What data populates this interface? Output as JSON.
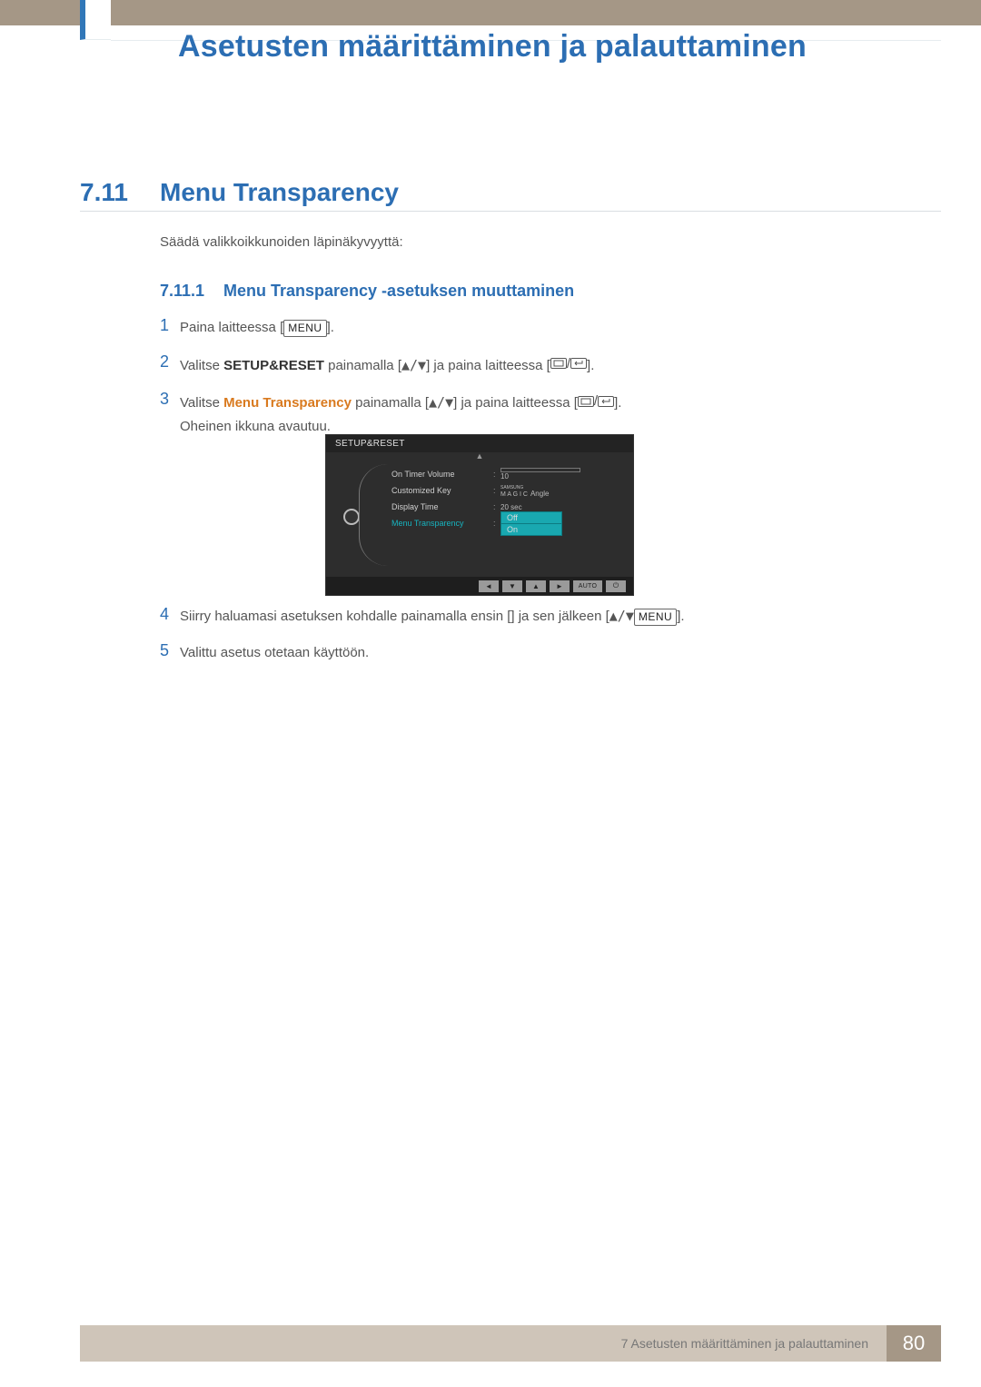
{
  "chapter_title": "Asetusten määrittäminen ja palauttaminen",
  "section": {
    "number": "7.11",
    "title": "Menu Transparency"
  },
  "intro_paragraph": "Säädä valikkoikkunoiden läpinäkyvyyttä:",
  "subsection": {
    "number": "7.11.1",
    "title": "Menu Transparency -asetuksen muuttaminen"
  },
  "buttons": {
    "menu": "MENU"
  },
  "steps": [
    {
      "n": "1",
      "before": "Paina laitteessa [",
      "insert": "menu",
      "after": "]."
    },
    {
      "n": "2",
      "before": "Valitse ",
      "highlight": "SETUP&RESET",
      "highlight_class": "bold-dark",
      "mid": " painamalla [",
      "arrows": true,
      "mid2": "] ja paina laitteessa [",
      "rt": true,
      "after": "]."
    },
    {
      "n": "3",
      "before": "Valitse ",
      "highlight": "Menu Transparency",
      "highlight_class": "bold-orange",
      "mid": " painamalla [",
      "arrows": true,
      "mid2": "] ja paina laitteessa [",
      "rt": true,
      "after": "].",
      "tail": "Oheinen ikkuna avautuu."
    }
  ],
  "osd": {
    "title": "SETUP&RESET",
    "rows": [
      {
        "label": "On Timer  Volume",
        "value": "10",
        "type": "slider"
      },
      {
        "label": "Customized Key",
        "value": "Angle",
        "type": "magic"
      },
      {
        "label": "Display Time",
        "value": "20 sec",
        "type": "text"
      },
      {
        "label": "Menu Transparency",
        "value": [
          "Off",
          "On"
        ],
        "type": "select",
        "active": true
      }
    ],
    "magic_label_top": "SAMSUNG",
    "magic_label_bottom": "M A G I C",
    "auto_label": "AUTO"
  },
  "steps2": [
    {
      "n": "4",
      "before": "Siirry haluamasi asetuksen kohdalle painamalla ensin [",
      "arrows": true,
      "mid": "] ja sen jälkeen [",
      "insert": "menu",
      "after": "]."
    },
    {
      "n": "5",
      "before": "Valittu asetus otetaan käyttöön."
    }
  ],
  "footer": {
    "text": "7 Asetusten määrittäminen ja palauttaminen",
    "page": "80"
  }
}
